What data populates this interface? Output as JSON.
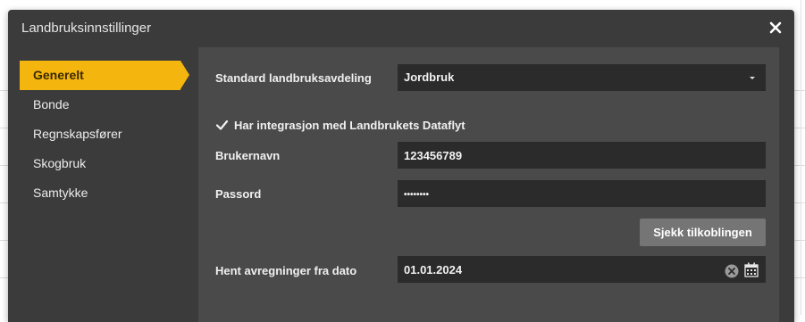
{
  "dialog": {
    "title": "Landbruksinnstillinger",
    "close_icon": "close-icon"
  },
  "sidebar": {
    "items": [
      {
        "label": "Generelt",
        "active": true
      },
      {
        "label": "Bonde",
        "active": false
      },
      {
        "label": "Regnskapsfører",
        "active": false
      },
      {
        "label": "Skogbruk",
        "active": false
      },
      {
        "label": "Samtykke",
        "active": false
      }
    ]
  },
  "form": {
    "department_label": "Standard landbruksavdeling",
    "department_value": "Jordbruk",
    "integration_label": "Har integrasjon med Landbrukets Dataflyt",
    "integration_checked": true,
    "username_label": "Brukernavn",
    "username_value": "123456789",
    "password_label": "Passord",
    "password_value": "••••••••",
    "test_connection_label": "Sjekk tilkoblingen",
    "date_label": "Hent avregninger fra dato",
    "date_value": "01.01.2024"
  },
  "colors": {
    "accent": "#f5b50f",
    "dialog_bg": "#3b3b3b",
    "content_bg": "#4a4a4a",
    "field_bg": "#2b2b2b",
    "button_bg": "#757575"
  }
}
